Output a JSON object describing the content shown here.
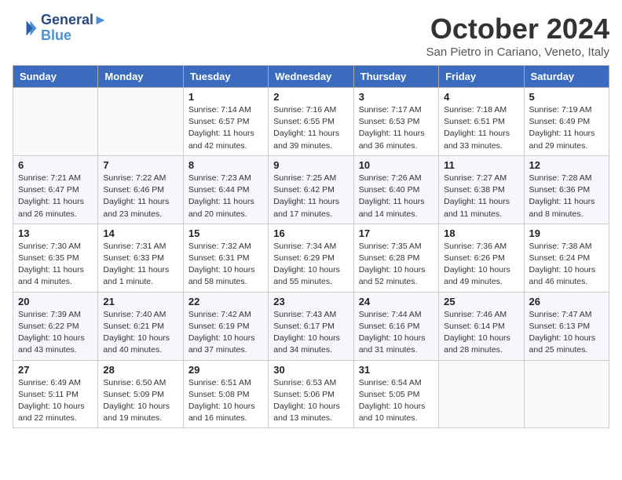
{
  "header": {
    "logo_line1": "General",
    "logo_line2": "Blue",
    "month_title": "October 2024",
    "location": "San Pietro in Cariano, Veneto, Italy"
  },
  "weekdays": [
    "Sunday",
    "Monday",
    "Tuesday",
    "Wednesday",
    "Thursday",
    "Friday",
    "Saturday"
  ],
  "weeks": [
    [
      {
        "day": "",
        "info": ""
      },
      {
        "day": "",
        "info": ""
      },
      {
        "day": "1",
        "info": "Sunrise: 7:14 AM\nSunset: 6:57 PM\nDaylight: 11 hours and 42 minutes."
      },
      {
        "day": "2",
        "info": "Sunrise: 7:16 AM\nSunset: 6:55 PM\nDaylight: 11 hours and 39 minutes."
      },
      {
        "day": "3",
        "info": "Sunrise: 7:17 AM\nSunset: 6:53 PM\nDaylight: 11 hours and 36 minutes."
      },
      {
        "day": "4",
        "info": "Sunrise: 7:18 AM\nSunset: 6:51 PM\nDaylight: 11 hours and 33 minutes."
      },
      {
        "day": "5",
        "info": "Sunrise: 7:19 AM\nSunset: 6:49 PM\nDaylight: 11 hours and 29 minutes."
      }
    ],
    [
      {
        "day": "6",
        "info": "Sunrise: 7:21 AM\nSunset: 6:47 PM\nDaylight: 11 hours and 26 minutes."
      },
      {
        "day": "7",
        "info": "Sunrise: 7:22 AM\nSunset: 6:46 PM\nDaylight: 11 hours and 23 minutes."
      },
      {
        "day": "8",
        "info": "Sunrise: 7:23 AM\nSunset: 6:44 PM\nDaylight: 11 hours and 20 minutes."
      },
      {
        "day": "9",
        "info": "Sunrise: 7:25 AM\nSunset: 6:42 PM\nDaylight: 11 hours and 17 minutes."
      },
      {
        "day": "10",
        "info": "Sunrise: 7:26 AM\nSunset: 6:40 PM\nDaylight: 11 hours and 14 minutes."
      },
      {
        "day": "11",
        "info": "Sunrise: 7:27 AM\nSunset: 6:38 PM\nDaylight: 11 hours and 11 minutes."
      },
      {
        "day": "12",
        "info": "Sunrise: 7:28 AM\nSunset: 6:36 PM\nDaylight: 11 hours and 8 minutes."
      }
    ],
    [
      {
        "day": "13",
        "info": "Sunrise: 7:30 AM\nSunset: 6:35 PM\nDaylight: 11 hours and 4 minutes."
      },
      {
        "day": "14",
        "info": "Sunrise: 7:31 AM\nSunset: 6:33 PM\nDaylight: 11 hours and 1 minute."
      },
      {
        "day": "15",
        "info": "Sunrise: 7:32 AM\nSunset: 6:31 PM\nDaylight: 10 hours and 58 minutes."
      },
      {
        "day": "16",
        "info": "Sunrise: 7:34 AM\nSunset: 6:29 PM\nDaylight: 10 hours and 55 minutes."
      },
      {
        "day": "17",
        "info": "Sunrise: 7:35 AM\nSunset: 6:28 PM\nDaylight: 10 hours and 52 minutes."
      },
      {
        "day": "18",
        "info": "Sunrise: 7:36 AM\nSunset: 6:26 PM\nDaylight: 10 hours and 49 minutes."
      },
      {
        "day": "19",
        "info": "Sunrise: 7:38 AM\nSunset: 6:24 PM\nDaylight: 10 hours and 46 minutes."
      }
    ],
    [
      {
        "day": "20",
        "info": "Sunrise: 7:39 AM\nSunset: 6:22 PM\nDaylight: 10 hours and 43 minutes."
      },
      {
        "day": "21",
        "info": "Sunrise: 7:40 AM\nSunset: 6:21 PM\nDaylight: 10 hours and 40 minutes."
      },
      {
        "day": "22",
        "info": "Sunrise: 7:42 AM\nSunset: 6:19 PM\nDaylight: 10 hours and 37 minutes."
      },
      {
        "day": "23",
        "info": "Sunrise: 7:43 AM\nSunset: 6:17 PM\nDaylight: 10 hours and 34 minutes."
      },
      {
        "day": "24",
        "info": "Sunrise: 7:44 AM\nSunset: 6:16 PM\nDaylight: 10 hours and 31 minutes."
      },
      {
        "day": "25",
        "info": "Sunrise: 7:46 AM\nSunset: 6:14 PM\nDaylight: 10 hours and 28 minutes."
      },
      {
        "day": "26",
        "info": "Sunrise: 7:47 AM\nSunset: 6:13 PM\nDaylight: 10 hours and 25 minutes."
      }
    ],
    [
      {
        "day": "27",
        "info": "Sunrise: 6:49 AM\nSunset: 5:11 PM\nDaylight: 10 hours and 22 minutes."
      },
      {
        "day": "28",
        "info": "Sunrise: 6:50 AM\nSunset: 5:09 PM\nDaylight: 10 hours and 19 minutes."
      },
      {
        "day": "29",
        "info": "Sunrise: 6:51 AM\nSunset: 5:08 PM\nDaylight: 10 hours and 16 minutes."
      },
      {
        "day": "30",
        "info": "Sunrise: 6:53 AM\nSunset: 5:06 PM\nDaylight: 10 hours and 13 minutes."
      },
      {
        "day": "31",
        "info": "Sunrise: 6:54 AM\nSunset: 5:05 PM\nDaylight: 10 hours and 10 minutes."
      },
      {
        "day": "",
        "info": ""
      },
      {
        "day": "",
        "info": ""
      }
    ]
  ]
}
